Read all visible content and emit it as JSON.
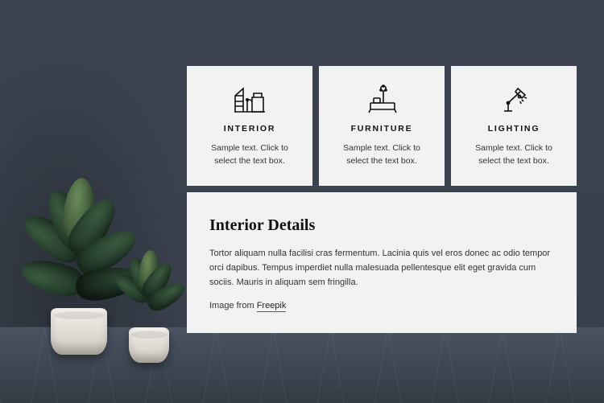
{
  "cards": [
    {
      "title": "INTERIOR",
      "text": "Sample text. Click to select the text box."
    },
    {
      "title": "FURNITURE",
      "text": "Sample text. Click to select the text box."
    },
    {
      "title": "LIGHTING",
      "text": "Sample text. Click to select the text box."
    }
  ],
  "details": {
    "heading": "Interior Details",
    "body": "Tortor aliquam nulla facilisi cras fermentum. Lacinia quis vel eros donec ac odio tempor orci dapibus. Tempus imperdiet nulla malesuada pellentesque elit eget gravida cum sociis. Mauris in aliquam sem fringilla.",
    "credit_prefix": "Image from ",
    "credit_link_text": "Freepik"
  }
}
